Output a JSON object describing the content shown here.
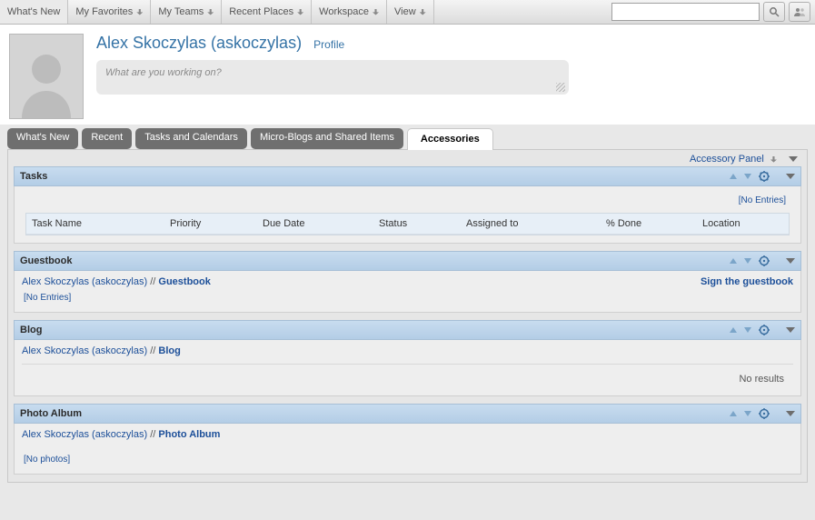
{
  "topMenu": [
    "What's New",
    "My Favorites",
    "My Teams",
    "Recent Places",
    "Workspace",
    "View"
  ],
  "search": {
    "placeholder": ""
  },
  "profile": {
    "name": "Alex Skoczylas (askoczylas)",
    "profileLink": "Profile",
    "statusPlaceholder": "What are you working on?"
  },
  "tabs": {
    "items": [
      "What's New",
      "Recent",
      "Tasks and Calendars",
      "Micro-Blogs and Shared Items"
    ],
    "active": "Accessories"
  },
  "accessoryPanelLabel": "Accessory Panel",
  "sections": {
    "tasks": {
      "title": "Tasks",
      "noEntries": "[No Entries]",
      "columns": [
        "Task Name",
        "Priority",
        "Due Date",
        "Status",
        "Assigned to",
        "% Done",
        "Location"
      ]
    },
    "guestbook": {
      "title": "Guestbook",
      "owner": "Alex Skoczylas (askoczylas)",
      "sep": " // ",
      "link": "Guestbook",
      "action": "Sign the guestbook",
      "noEntries": "[No Entries]"
    },
    "blog": {
      "title": "Blog",
      "owner": "Alex Skoczylas (askoczylas)",
      "sep": " // ",
      "link": "Blog",
      "noResults": "No results"
    },
    "photo": {
      "title": "Photo Album",
      "owner": "Alex Skoczylas (askoczylas)",
      "sep": " // ",
      "link": "Photo Album",
      "noPhotos": "[No photos]"
    }
  }
}
